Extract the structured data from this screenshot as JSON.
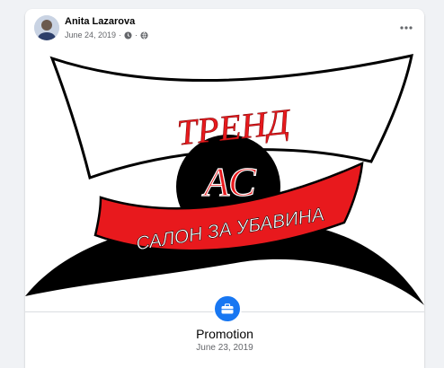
{
  "post": {
    "author": "Anita Lazarova",
    "date": "June 24, 2019",
    "separator": "·",
    "privacy_icon": "globe-icon",
    "clock_icon": "clock-icon",
    "more_icon": "more-options-icon"
  },
  "image": {
    "logo_title": "ТРЕНД",
    "logo_center": "АС",
    "logo_banner": "САЛОН ЗА УБАВИНА",
    "colors": {
      "red": "#e8191d",
      "black": "#000000",
      "white": "#ffffff"
    }
  },
  "life_event": {
    "icon": "briefcase-icon",
    "accent": "#1877f2",
    "title": "Promotion",
    "date": "June 23, 2019"
  }
}
